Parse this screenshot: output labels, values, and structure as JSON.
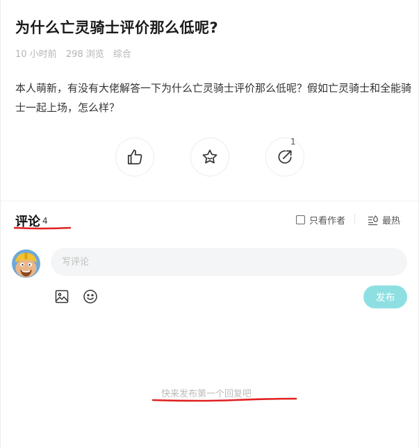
{
  "post": {
    "title": "为什么亡灵骑士评价那么低呢?",
    "time": "10 小时前",
    "views": "298 浏览",
    "category": "综合",
    "body": "本人萌新，有没有大佬解答一下为什么亡灵骑士评价那么低呢？假如亡灵骑士和全能骑士一起上场，怎么样？",
    "share_count": "1"
  },
  "actions": [
    {
      "icon": "thumbs-up-icon"
    },
    {
      "icon": "star-icon"
    },
    {
      "icon": "share-icon"
    }
  ],
  "comments": {
    "title": "评论",
    "count": "4",
    "only_author_label": "只看作者",
    "sort_label": "最热",
    "input_placeholder": "写评论",
    "publish_label": "发布",
    "empty_text": "快来发布第一个回复吧"
  },
  "colors": {
    "accent": "#8ddfe2",
    "annotation_red": "#e02020",
    "muted_text": "#b5b5b5"
  }
}
